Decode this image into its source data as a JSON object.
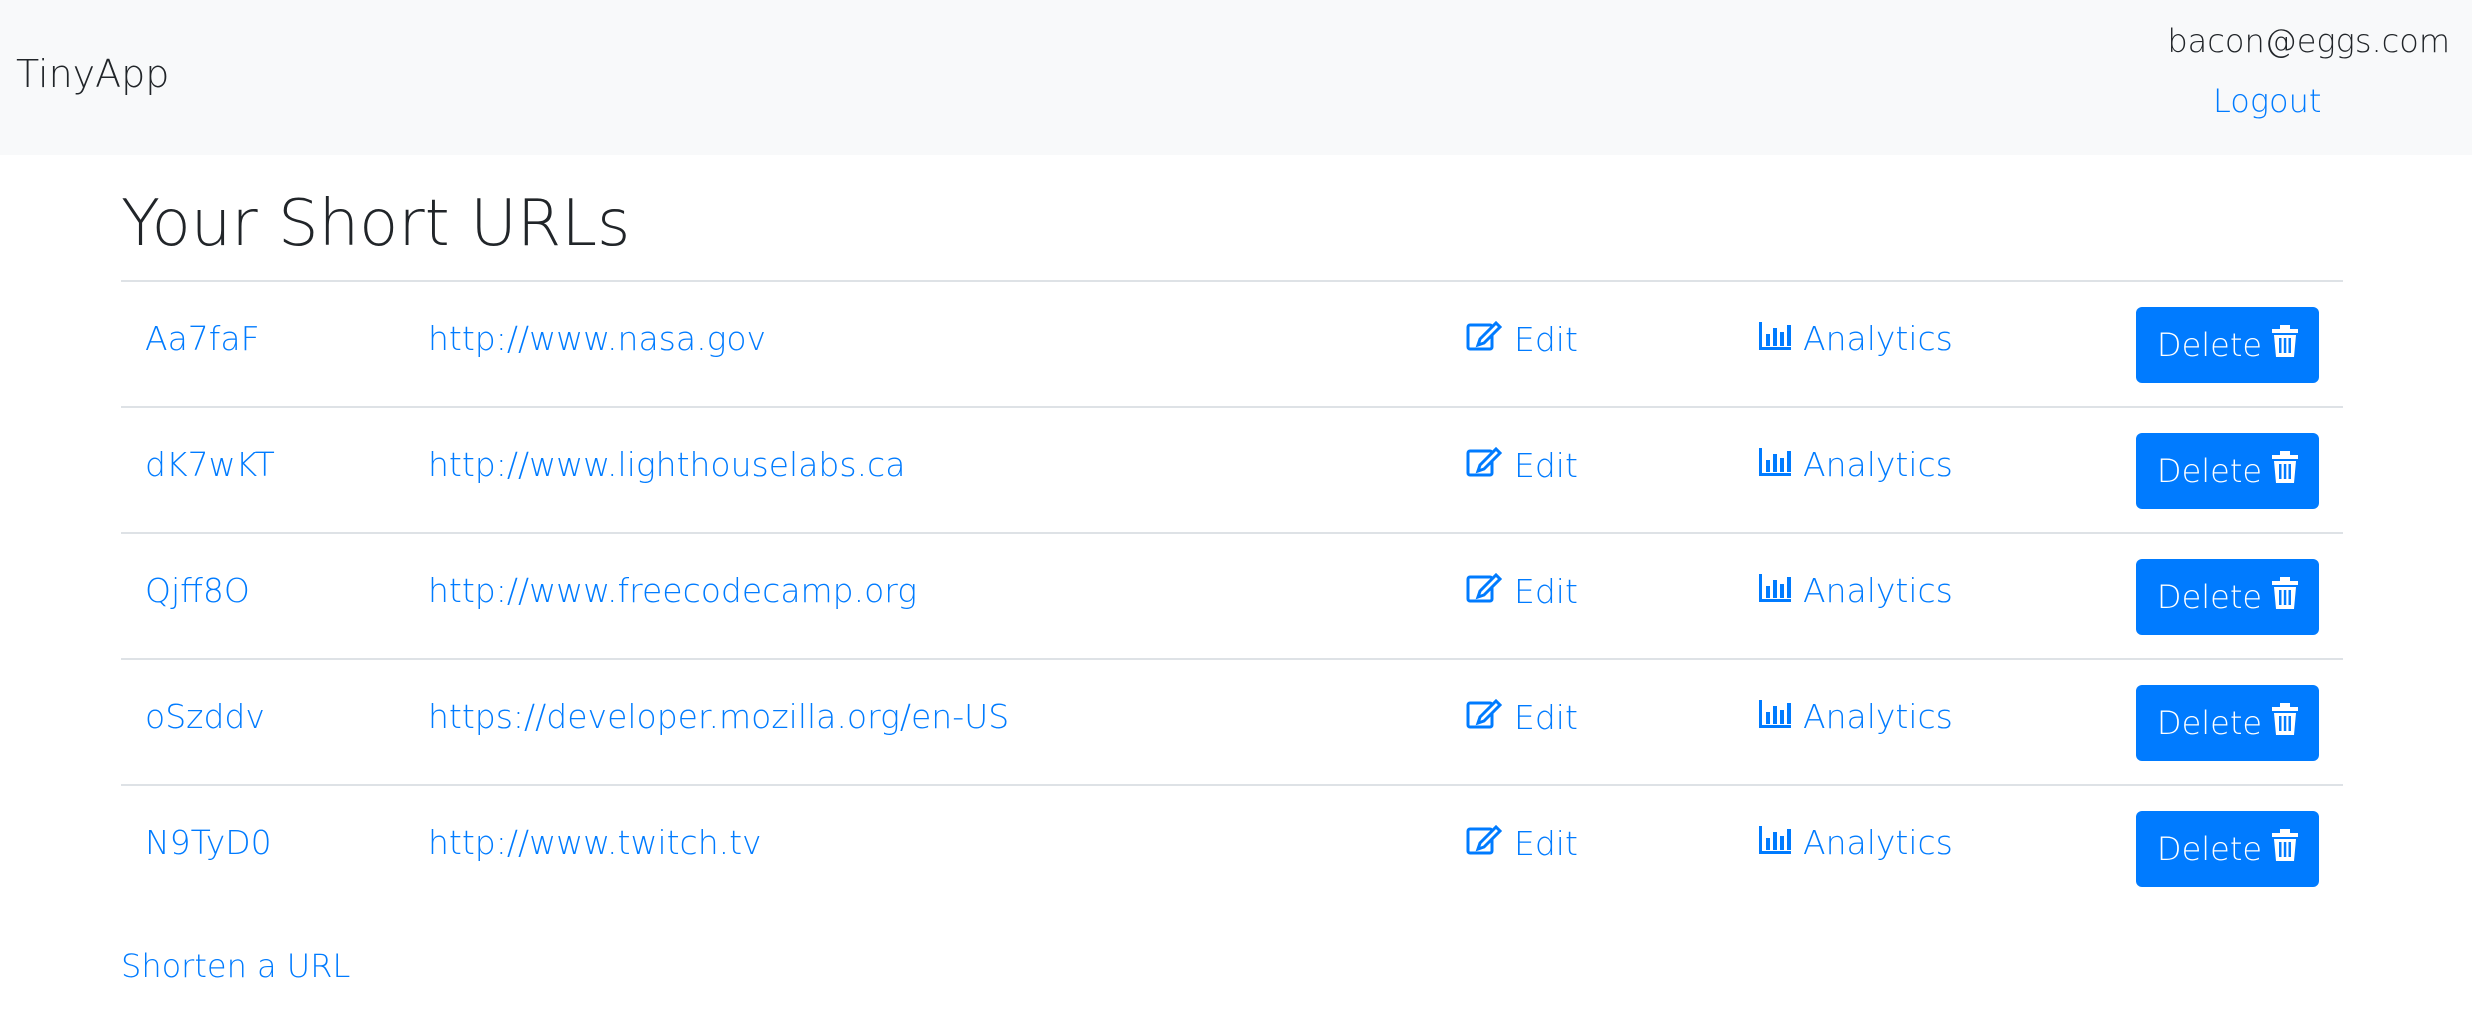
{
  "navbar": {
    "brand": "TinyApp",
    "user_email": "bacon@eggs.com",
    "logout_label": "Logout"
  },
  "main": {
    "title": "Your Short URLs",
    "edit_label": "Edit",
    "analytics_label": "Analytics",
    "delete_label": "Delete",
    "urls": [
      {
        "short": "Aa7faF",
        "long": "http://www.nasa.gov"
      },
      {
        "short": "dK7wKT",
        "long": "http://www.lighthouselabs.ca"
      },
      {
        "short": "Qjff8O",
        "long": "http://www.freecodecamp.org"
      },
      {
        "short": "oSzddv",
        "long": "https://developer.mozilla.org/en-US"
      },
      {
        "short": "N9TyD0",
        "long": "http://www.twitch.tv"
      }
    ],
    "shorten_link_label": "Shorten a URL"
  },
  "colors": {
    "accent": "#007bff",
    "navbar_bg": "#f8f9fa",
    "text": "#212529"
  },
  "icons": {
    "edit": "edit-icon",
    "analytics": "bar-chart-icon",
    "delete": "trash-icon"
  }
}
